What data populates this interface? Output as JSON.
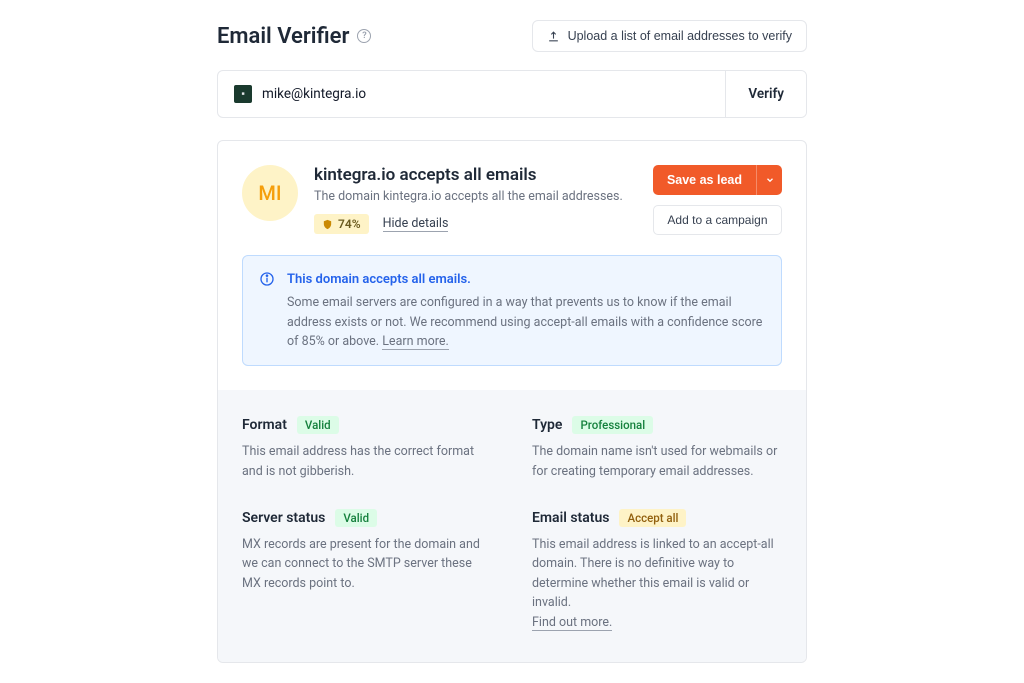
{
  "header": {
    "title": "Email Verifier",
    "upload_label": "Upload a list of email addresses to verify"
  },
  "input": {
    "email": "mike@kintegra.io",
    "verify_label": "Verify"
  },
  "result": {
    "avatar_initials": "MI",
    "title": "kintegra.io accepts all emails",
    "subtitle": "The domain kintegra.io accepts all the email addresses.",
    "confidence": "74%",
    "hide_details_label": "Hide details",
    "save_lead_label": "Save as lead",
    "add_campaign_label": "Add to a campaign"
  },
  "alert": {
    "title": "This domain accepts all emails.",
    "body": "Some email servers are configured in a way that prevents us to know if the email address exists or not. We recommend using accept-all emails with a confidence score of 85% or above. ",
    "learn_more": "Learn more."
  },
  "details": {
    "format": {
      "label": "Format",
      "badge": "Valid",
      "desc": "This email address has the correct format and is not gibberish."
    },
    "type": {
      "label": "Type",
      "badge": "Professional",
      "desc": "The domain name isn't used for webmails or for creating temporary email addresses."
    },
    "server": {
      "label": "Server status",
      "badge": "Valid",
      "desc": "MX records are present for the domain and we can connect to the SMTP server these MX records point to."
    },
    "email_status": {
      "label": "Email status",
      "badge": "Accept all",
      "desc": "This email address is linked to an accept-all domain. There is no definitive way to determine whether this email is valid or invalid.",
      "find_out": "Find out more."
    }
  },
  "colors": {
    "accent_orange": "#f15a29",
    "info_blue": "#2563eb"
  }
}
